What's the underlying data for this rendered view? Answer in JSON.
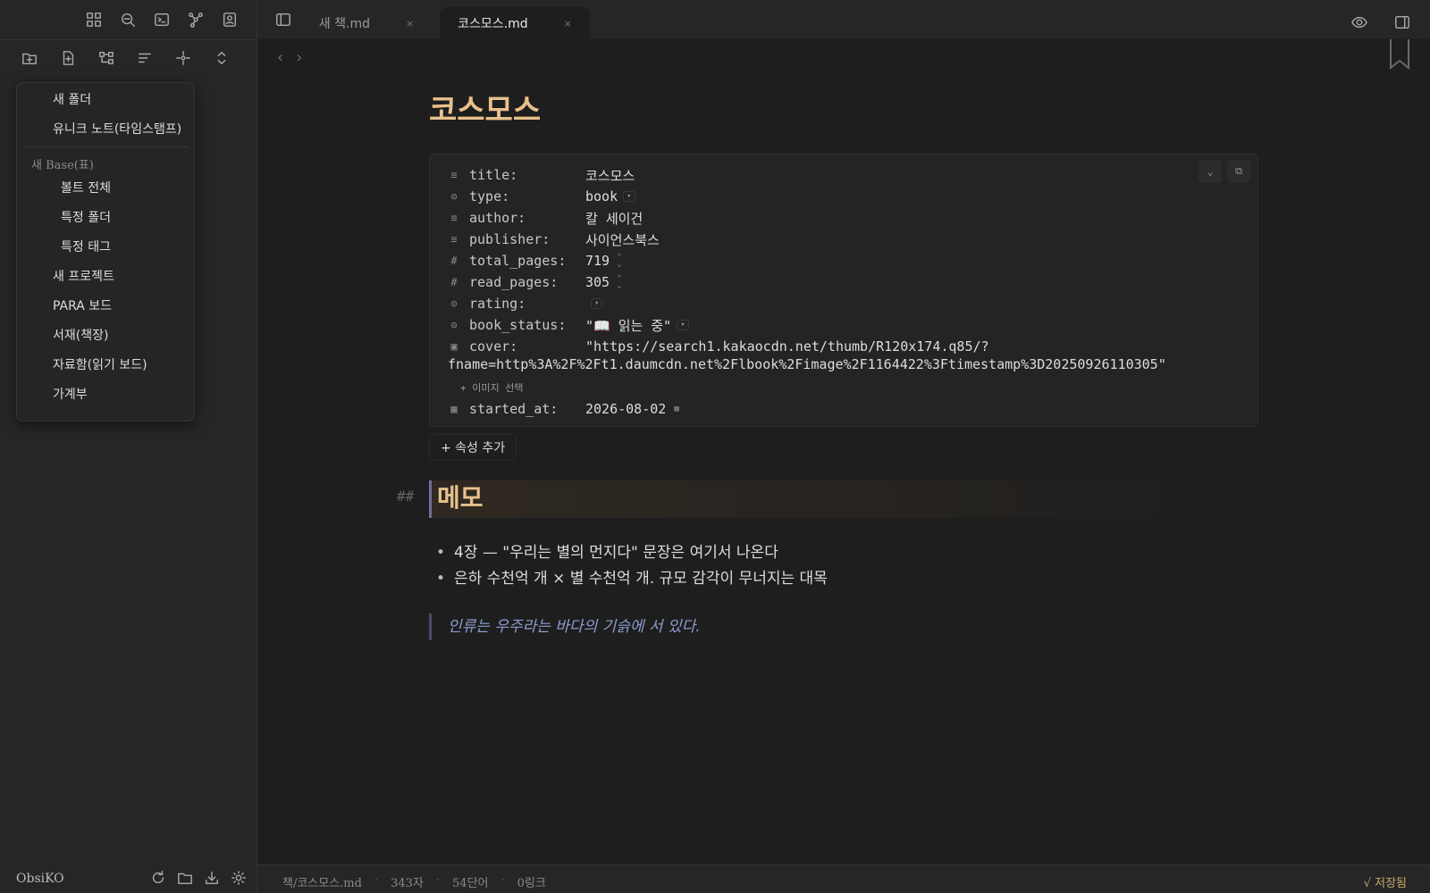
{
  "sidebar": {
    "vault_name": "ObsiKO",
    "top_icons": [
      "dashboard-icon",
      "search-icon",
      "terminal-icon",
      "graph-icon",
      "profile-icon"
    ],
    "nav_icons": [
      "new-folder-icon",
      "new-note-icon",
      "canvas-icon",
      "sort-icon",
      "locate-icon",
      "collapse-icon"
    ],
    "footer_icons": [
      "refresh-icon",
      "folder-icon",
      "download-icon",
      "settings-icon"
    ]
  },
  "menu": {
    "new_folder": "새 폴더",
    "unique_note": "유니크 노트(타임스탬프)",
    "base_group": "새 Base(표)",
    "base_items": [
      "볼트 전체",
      "특정 폴더",
      "특정 태그"
    ],
    "items": [
      "새 프로젝트",
      "PARA 보드",
      "서재(책장)",
      "자료함(읽기 보드)",
      "가계부"
    ]
  },
  "tabs": [
    {
      "label": "새 책.md",
      "close": "×",
      "active": false
    },
    {
      "label": "코스모스.md",
      "close": "×",
      "active": true
    }
  ],
  "editor": {
    "title": "코스모스",
    "properties": {
      "title": {
        "key": "title:",
        "value": "코스모스",
        "icon": "text-icon"
      },
      "type": {
        "key": "type:",
        "value": "book",
        "icon": "list-icon"
      },
      "author": {
        "key": "author:",
        "value": "칼 세이건",
        "icon": "text-icon"
      },
      "publisher": {
        "key": "publisher:",
        "value": "사이언스북스",
        "icon": "text-icon"
      },
      "total_pages": {
        "key": "total_pages:",
        "value": "719",
        "icon": "number-icon"
      },
      "read_pages": {
        "key": "read_pages:",
        "value": "305",
        "icon": "number-icon"
      },
      "rating": {
        "key": "rating:",
        "value": "",
        "icon": "list-icon"
      },
      "book_status": {
        "key": "book_status:",
        "value": "\"📖 읽는 중\"",
        "icon": "list-icon"
      },
      "cover": {
        "key": "cover:",
        "value_line1": "\"https://search1.kakaocdn.net/thumb/R120x174.q85/?",
        "value_line2": "fname=http%3A%2F%2Ft1.daumcdn.net%2Flbook%2Fimage%2F1164422%3Ftimestamp%3D20250926110305\"",
        "icon": "image-icon",
        "image_button": "+ 이미지 선택"
      },
      "started_at": {
        "key": "started_at:",
        "value": "2026-08-02",
        "icon": "calendar-icon"
      }
    },
    "add_property": "+ 속성 추가",
    "heading_marker": "##",
    "heading": "메모",
    "bullets": [
      "4장 — \"우리는 별의 먼지다\" 문장은 여기서 나온다",
      "은하 수천억 개 × 별 수천억 개. 규모 감각이 무너지는 대목"
    ],
    "quote": "인류는 우주라는 바다의 기슭에 서 있다."
  },
  "statusbar": {
    "path": "책/코스모스.md",
    "chars": "343자",
    "words": "54단어",
    "links": "0링크",
    "saved": "√ 저장됨"
  }
}
